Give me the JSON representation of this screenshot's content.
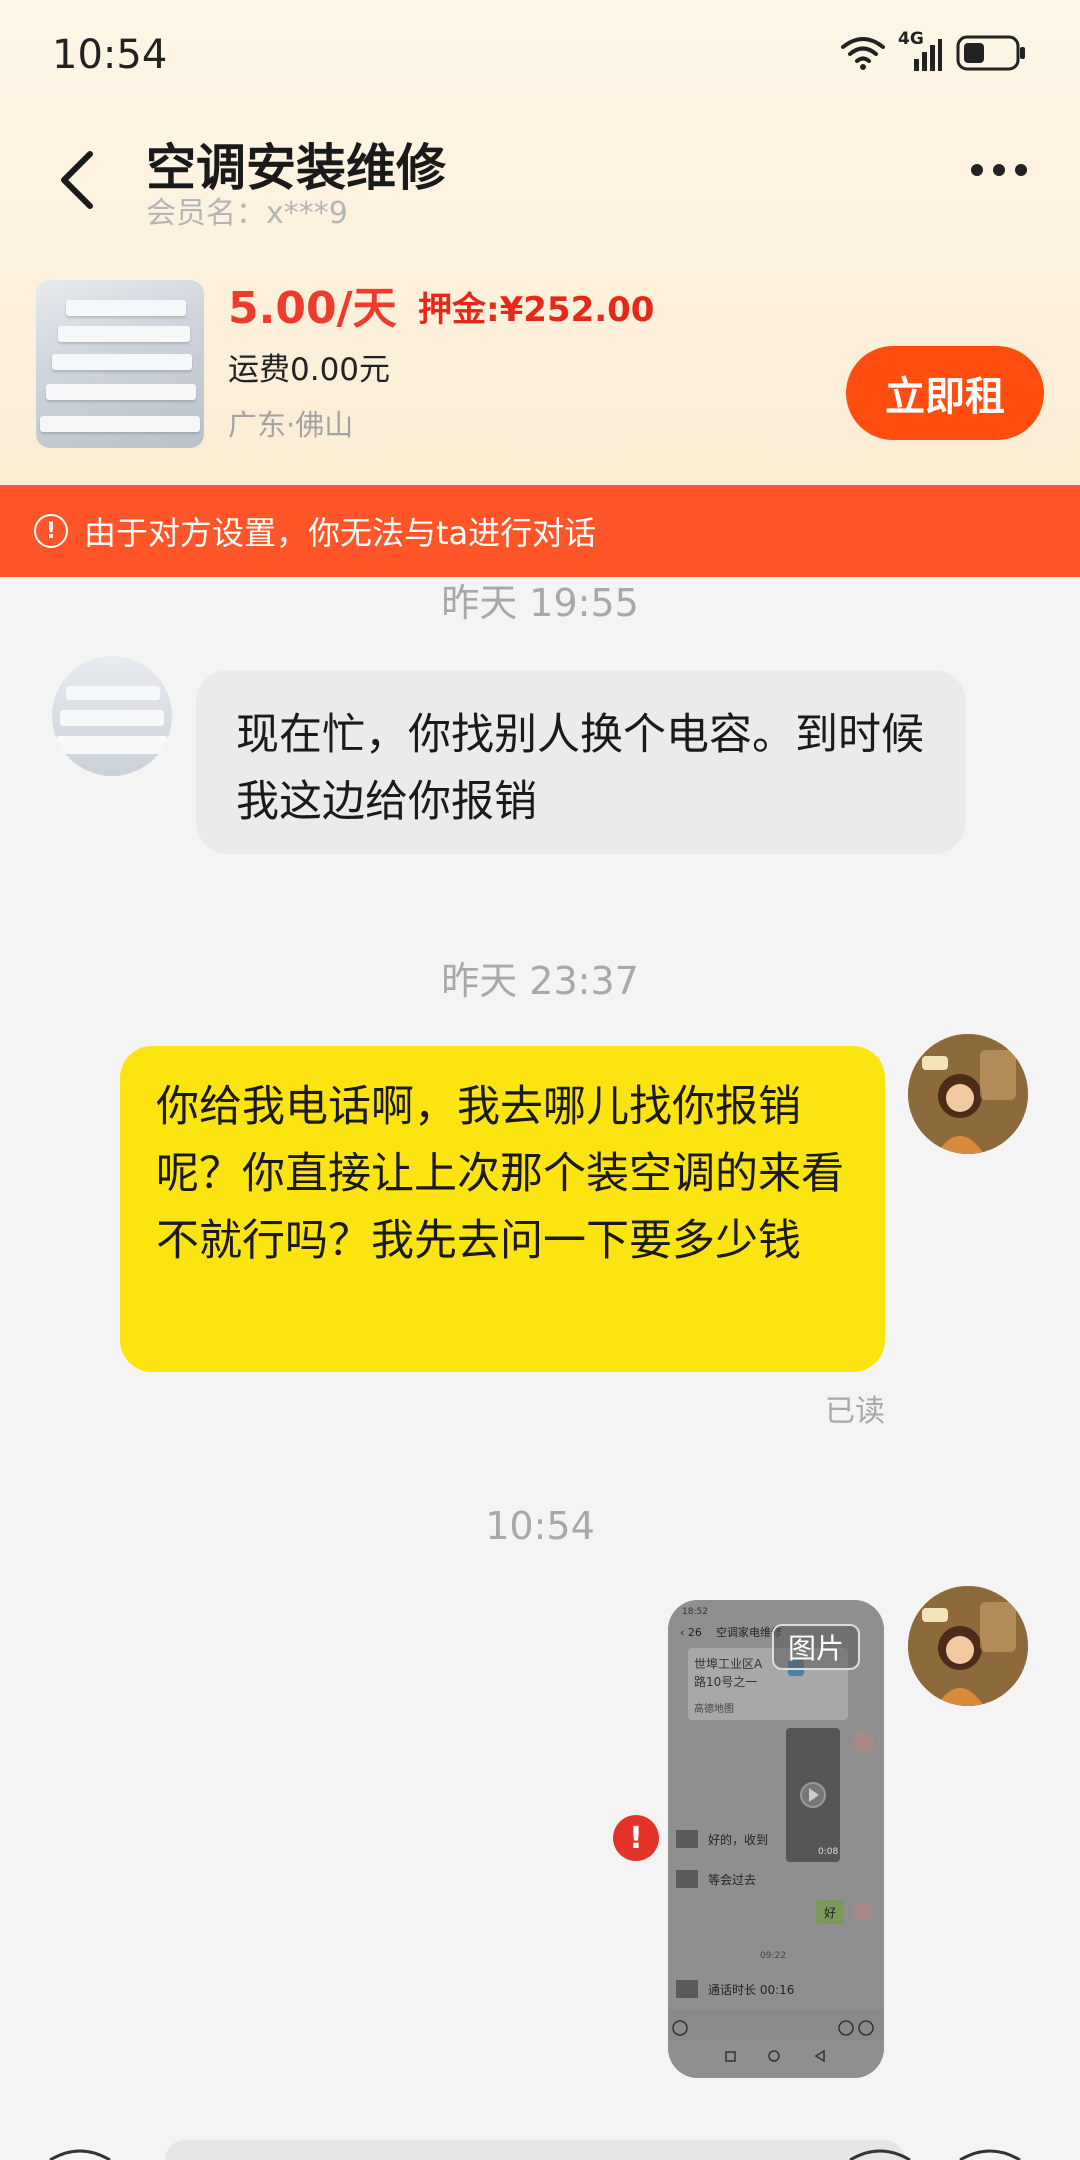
{
  "status_bar": {
    "time": "10:54",
    "network": "4G",
    "icons": [
      "wifi-icon",
      "signal-icon",
      "battery-icon"
    ]
  },
  "header": {
    "title": "空调安装维修",
    "member": "会员名：x***9",
    "icons": [
      "back-icon",
      "more-icon"
    ]
  },
  "product": {
    "price": "5.00/天",
    "deposit": "押金:¥252.00",
    "shipping": "运费0.00元",
    "location": "广东·佛山",
    "rent_label": "立即租"
  },
  "banner": {
    "icon": "!",
    "text": "由于对方设置，你无法与ta进行对话"
  },
  "messages": [
    {
      "timestamp": "昨天 19:55",
      "from": "shop",
      "text": "现在忙，你找别人换个电容。到时候我这边给你报销"
    },
    {
      "timestamp": "昨天 23:37",
      "from": "me",
      "text": "你给我电话啊，我去哪儿找你报销呢？你直接让上次那个装空调的来看不就行吗？我先去问一下要多少钱",
      "status": "已读"
    },
    {
      "timestamp": "10:54",
      "from": "me",
      "type": "image",
      "image_tag": "图片",
      "send_failed": "!",
      "screenshot": {
        "time": "18:52",
        "title": "空调家电维修",
        "addr_line1": "世埠工业区A",
        "addr_line2": "路10号之一",
        "map_label": "高德地图",
        "video_duration": "0:08",
        "msg1": "好的，收到",
        "msg2": "等会过去",
        "msg3": "好",
        "time2": "09:22",
        "call": "通话时长 00:16"
      }
    }
  ],
  "colors": {
    "accent": "#ff4d10",
    "banner": "#ff5529",
    "price": "#ef3b2c",
    "bubble_out": "#fce411",
    "bubble_in": "#ebebed"
  }
}
